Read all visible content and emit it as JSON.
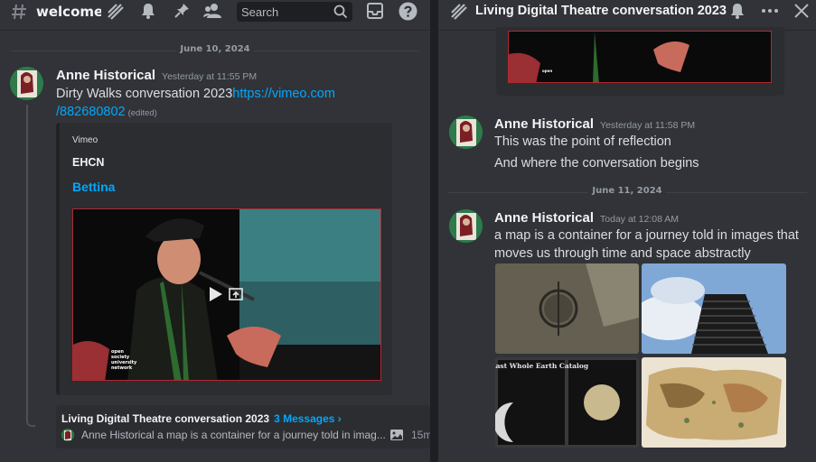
{
  "left": {
    "channel_name": "welcome-a",
    "search": {
      "placeholder": "Search"
    },
    "date_divider": "June 10, 2024",
    "message": {
      "author": "Anne Historical",
      "timestamp": "Yesterday at 11:55 PM",
      "text": "Dirty Walks conversation 2023",
      "link_part1": "https://vimeo.com",
      "link_part2": "/882680802",
      "edited": "(edited)"
    },
    "embed": {
      "provider": "Vimeo",
      "author": "EHCN",
      "title": "Bettina",
      "video_logo": [
        "open",
        "society",
        "university",
        "network"
      ]
    },
    "thread": {
      "name": "Living Digital Theatre conversation 2023",
      "count": "3 Messages ›",
      "preview_author": "Anne Historical",
      "preview_text": "a map is a container for a journey told in imag...",
      "time": "15m"
    }
  },
  "right": {
    "title": "Living Digital Theatre conversation 2023",
    "messages": [
      {
        "author": "Anne Historical",
        "timestamp": "Yesterday at 11:58 PM",
        "lines": [
          "This was the point of reflection",
          "And where the conversation begins"
        ]
      },
      {
        "author": "Anne Historical",
        "timestamp": "Today at 12:08 AM",
        "lines": [
          "a map is a container for a journey told in images that",
          "moves us through time and space abstractly"
        ]
      }
    ],
    "date_divider": "June 11, 2024",
    "gallery": {
      "catalog_title": "The Last Whole Earth Catalog"
    }
  },
  "colors": {
    "background": "#313338",
    "link": "#00a8fc",
    "video_border": "#b22830"
  }
}
